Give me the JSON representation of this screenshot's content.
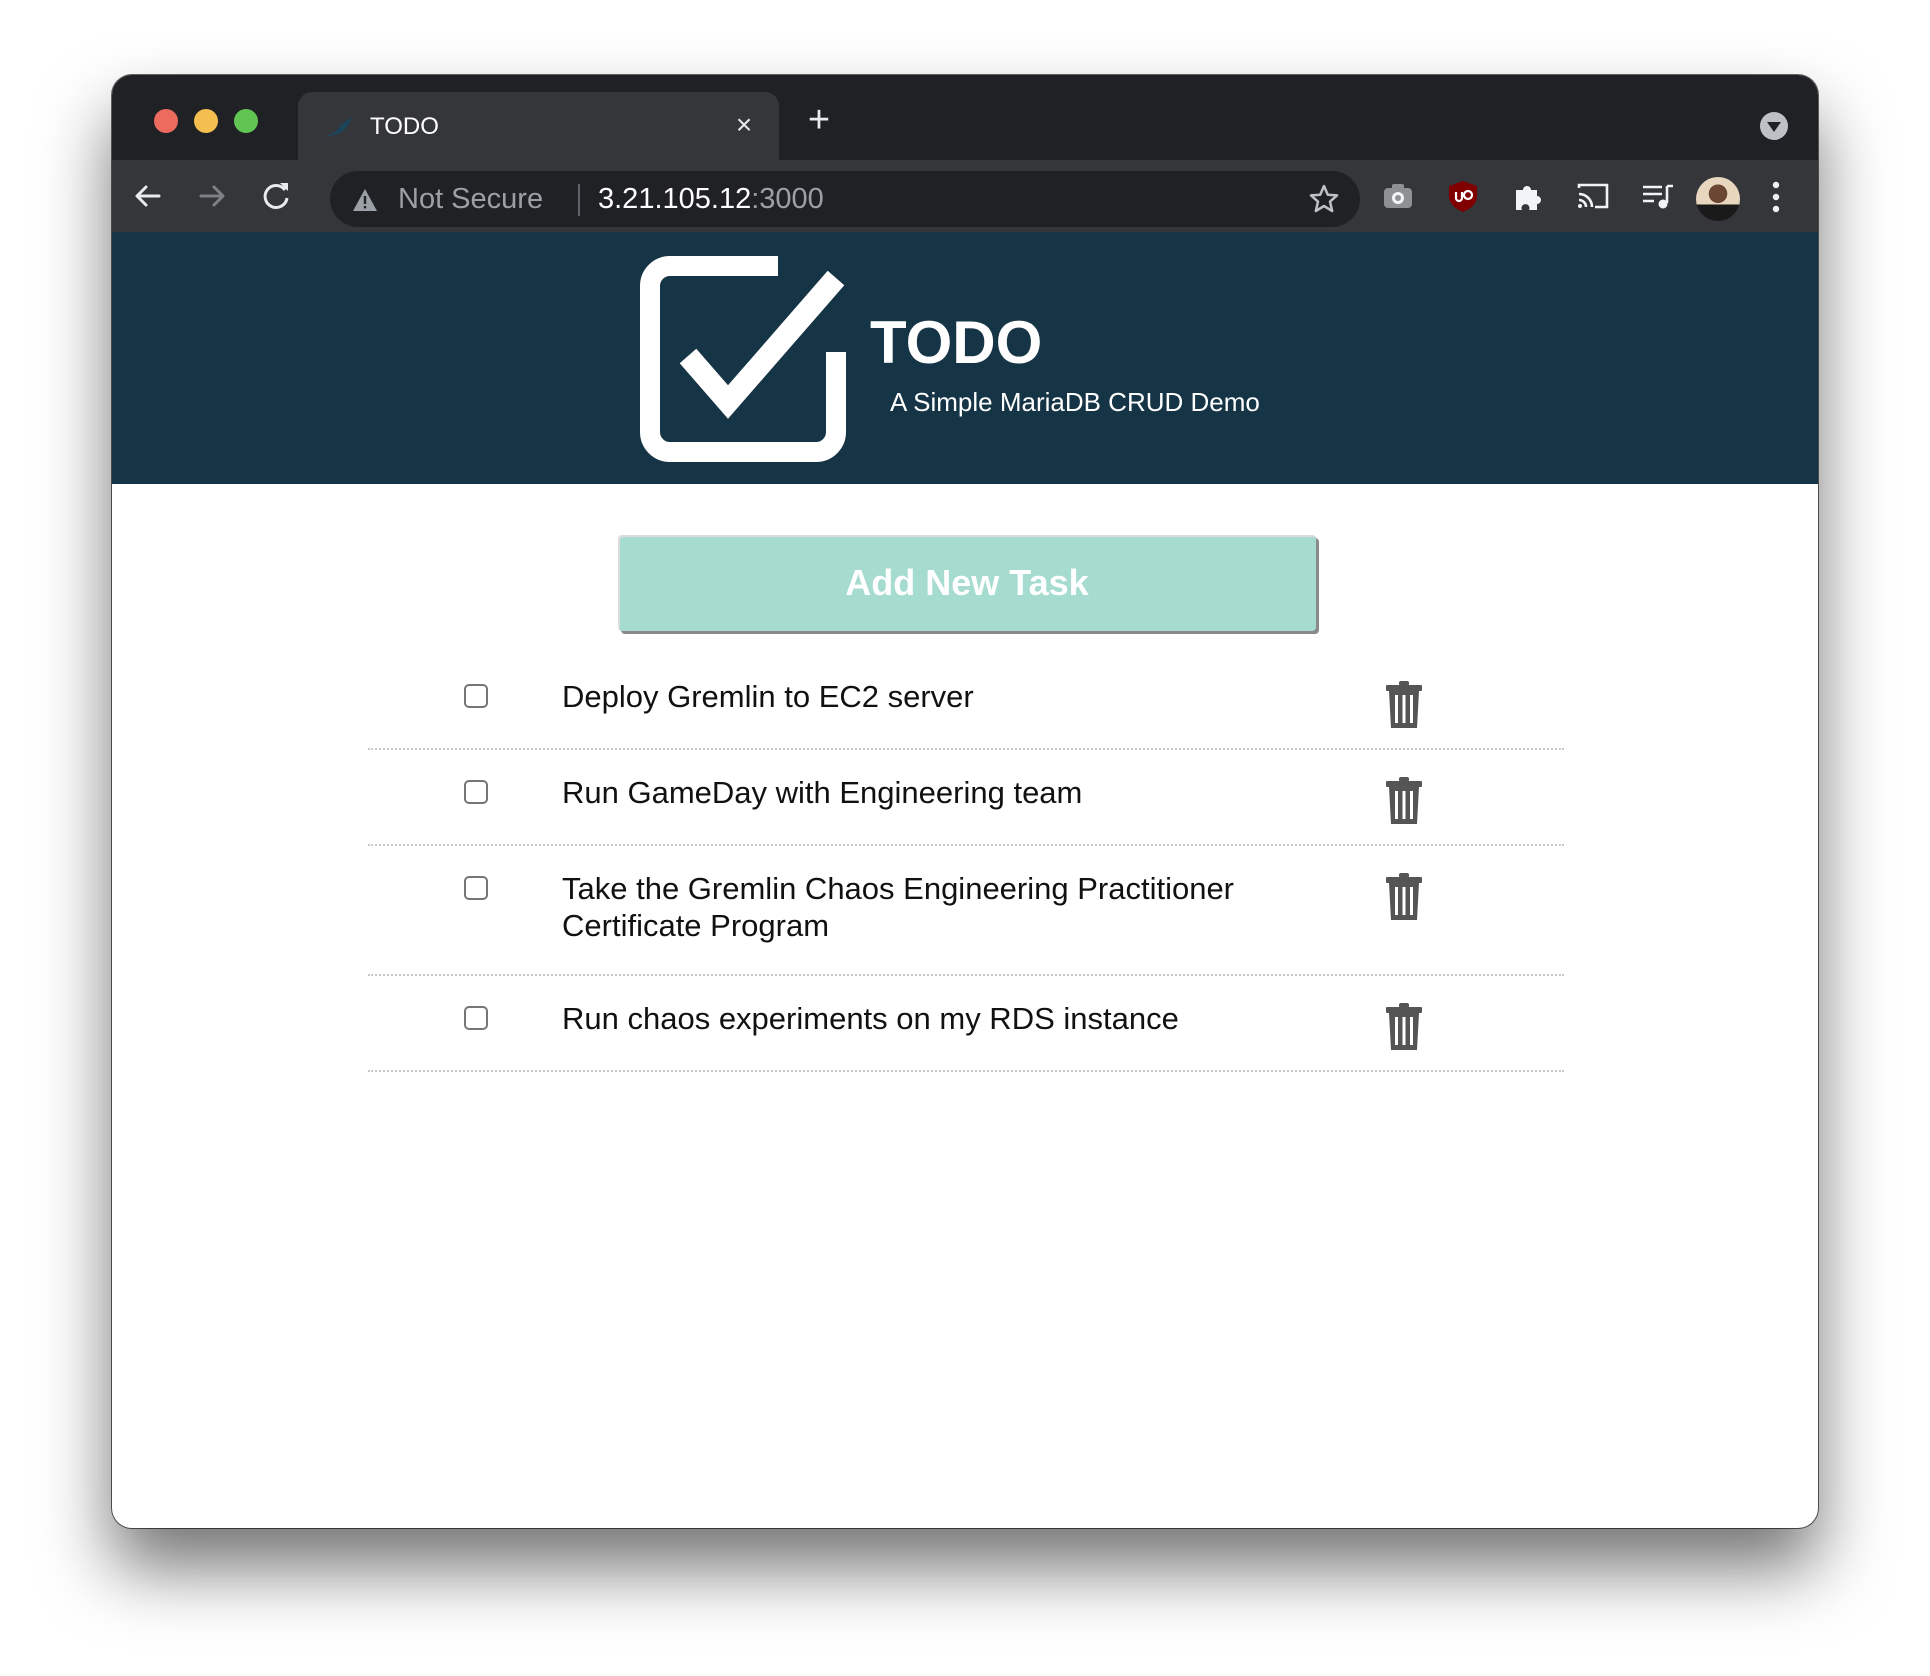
{
  "browser": {
    "tab": {
      "title": "TODO",
      "favicon": "mariadb-seal-icon",
      "close_label": "×"
    },
    "new_tab_label": "+",
    "address_bar": {
      "security_label": "Not Secure",
      "url_host": "3.21.105.12",
      "url_port": ":3000"
    },
    "toolbar_icons": [
      "back-icon",
      "forward-icon",
      "reload-icon",
      "star-icon",
      "camera-extension-icon",
      "ublock-origin-icon",
      "extensions-puzzle-icon",
      "cast-icon",
      "media-queue-icon",
      "profile-avatar",
      "menu-dots-icon"
    ]
  },
  "header": {
    "title": "TODO",
    "subtitle": "A Simple MariaDB CRUD Demo",
    "colors": {
      "background": "#153446",
      "text": "#ffffff"
    }
  },
  "actions": {
    "add_task_label": "Add New Task",
    "add_task_color": "#a6dbcf"
  },
  "tasks": [
    {
      "text": "Deploy Gremlin to EC2 server",
      "completed": false
    },
    {
      "text": "Run GameDay with Engineering team",
      "completed": false
    },
    {
      "text": "Take the Gremlin Chaos Engineering Practitioner Certificate Program",
      "completed": false
    },
    {
      "text": "Run chaos experiments on my RDS instance",
      "completed": false
    }
  ]
}
